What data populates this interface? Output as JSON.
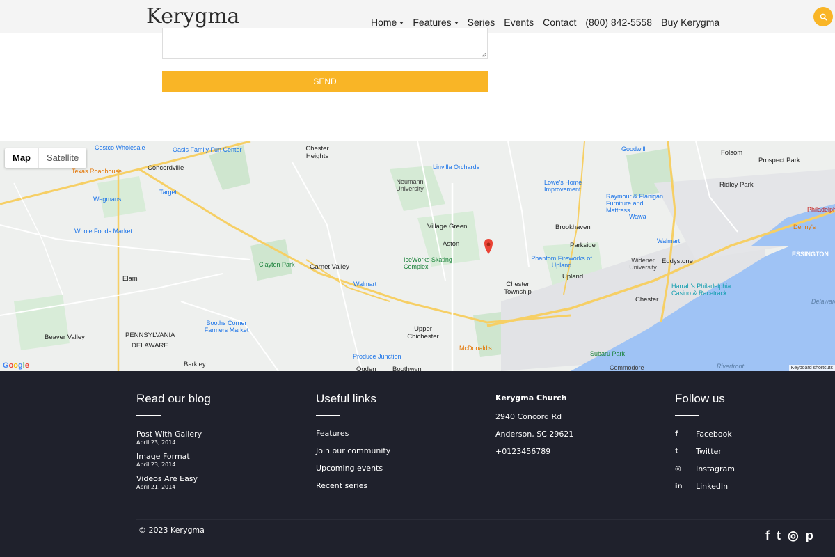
{
  "header": {
    "logo": "Kerygma",
    "nav": [
      {
        "label": "Home",
        "dropdown": true
      },
      {
        "label": "Features",
        "dropdown": true
      },
      {
        "label": "Series",
        "dropdown": false
      },
      {
        "label": "Events",
        "dropdown": false
      },
      {
        "label": "Contact",
        "dropdown": false
      },
      {
        "label": "(800) 842-5558",
        "dropdown": false
      },
      {
        "label": "Buy Kerygma",
        "dropdown": false
      }
    ],
    "search_icon": "search-icon",
    "accent_color": "#f9b526"
  },
  "form": {
    "send_label": "SEND"
  },
  "map": {
    "toggle": {
      "map": "Map",
      "satellite": "Satellite"
    },
    "keyboard_shortcuts": "Keyboard shortcuts",
    "google": "Google",
    "labels": {
      "costco": "Costco Wholesale",
      "oasis": "Oasis Family Fun Center",
      "chester_heights": "Chester Heights",
      "goodwill": "Goodwill",
      "folsom": "Folsom",
      "prospect_park": "Prospect Park",
      "concordville": "Concordville",
      "texas_roadhouse": "Texas Roadhouse",
      "target": "Target",
      "linvilla": "Linvilla Orchards",
      "neumann": "Neumann University",
      "lowes": "Lowe's Home Improvement",
      "ridley_park": "Ridley Park",
      "wegmans": "Wegmans",
      "raymour": "Raymour & Flanigan Furniture and Mattress...",
      "wawa": "Wawa",
      "philadelphia": "Philadelph",
      "dennys": "Denny's",
      "whole_foods": "Whole Foods Market",
      "village_green": "Village Green",
      "brookhaven": "Brookhaven",
      "aston": "Aston",
      "parkside": "Parkside",
      "walmart1": "Walmart",
      "widener": "Widener University",
      "essington": "ESSINGTON",
      "clayton_park": "Clayton Park",
      "garnet_valley": "Garnet Valley",
      "iceworks": "IceWorks Skating Complex",
      "phantom": "Phantom Fireworks of Upland",
      "eddystone": "Eddystone",
      "elam": "Elam",
      "walmart2": "Walmart",
      "chester_township": "Chester Township",
      "upland": "Upland",
      "harrahs": "Harrah's Philadelphia Casino & Racetrack",
      "chester": "Chester",
      "booths": "Booths Corner Farmers Market",
      "upper_chichester": "Upper Chichester",
      "beaver_valley": "Beaver Valley",
      "pennsylvania": "PENNSYLVANIA",
      "delaware": "DELAWARE",
      "mcdonalds": "McDonald's",
      "subaru": "Subaru Park",
      "produce": "Produce Junction",
      "barkley": "Barkley",
      "ogden": "Ogden",
      "boothwyn": "Boothwyn",
      "commodore": "Commodore",
      "riverfront": "Riverfront",
      "delaware_river": "Delaware River"
    }
  },
  "footer": {
    "blog": {
      "title": "Read our blog",
      "posts": [
        {
          "title": "Post With Gallery",
          "date": "April 23, 2014"
        },
        {
          "title": "Image Format",
          "date": "April 23, 2014"
        },
        {
          "title": "Videos Are Easy",
          "date": "April 21, 2014"
        }
      ]
    },
    "links": {
      "title": "Useful links",
      "items": [
        "Features",
        "Join our community",
        "Upcoming events",
        "Recent series"
      ]
    },
    "church": {
      "title": "Kerygma Church",
      "address1": "2940 Concord Rd",
      "address2": "Anderson, SC 29621",
      "phone": "+0123456789"
    },
    "follow": {
      "title": "Follow us",
      "items": [
        {
          "icon": "f",
          "label": "Facebook"
        },
        {
          "icon": "t",
          "label": "Twitter"
        },
        {
          "icon": "◎",
          "label": "Instagram"
        },
        {
          "icon": "in",
          "label": "LinkedIn"
        }
      ]
    },
    "copyright": "© 2023 Kerygma",
    "bottom_social": [
      "f",
      "t",
      "◎",
      "p"
    ],
    "bg_color": "#1f212c"
  }
}
